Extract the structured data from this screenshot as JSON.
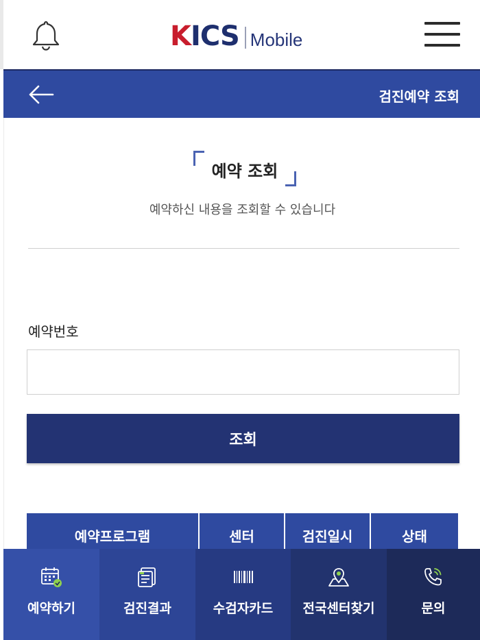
{
  "header": {
    "logo_kics": "KICS",
    "logo_mobile": "Mobile",
    "bell_icon": "bell-icon",
    "menu_icon": "hamburger-menu-icon"
  },
  "subheader": {
    "back_icon": "back-arrow-icon",
    "title": "검진예약 조회"
  },
  "main": {
    "title": "예약 조회",
    "subtitle": "예약하신 내용을 조회할 수 있습니다",
    "field_label": "예약번호",
    "field_value": "",
    "field_placeholder": "",
    "search_button": "조회",
    "table_headers": [
      "예약프로그램",
      "센터",
      "검진일시",
      "상태"
    ]
  },
  "bottom_nav": [
    {
      "label": "예약하기",
      "icon": "calendar-check-icon",
      "bg": "#3550a8"
    },
    {
      "label": "검진결과",
      "icon": "document-icon",
      "bg": "#2d4596"
    },
    {
      "label": "수검자카드",
      "icon": "barcode-icon",
      "bg": "#263a82"
    },
    {
      "label": "전국센터찾기",
      "icon": "map-pin-icon",
      "bg": "#22336e"
    },
    {
      "label": "문의",
      "icon": "phone-icon",
      "bg": "#1d2a59"
    }
  ],
  "colors": {
    "primary": "#2f4aa0",
    "button": "#233373",
    "logo_red": "#c81d2d",
    "logo_navy": "#1e2f6e",
    "accent_green": "#8fd14f"
  }
}
